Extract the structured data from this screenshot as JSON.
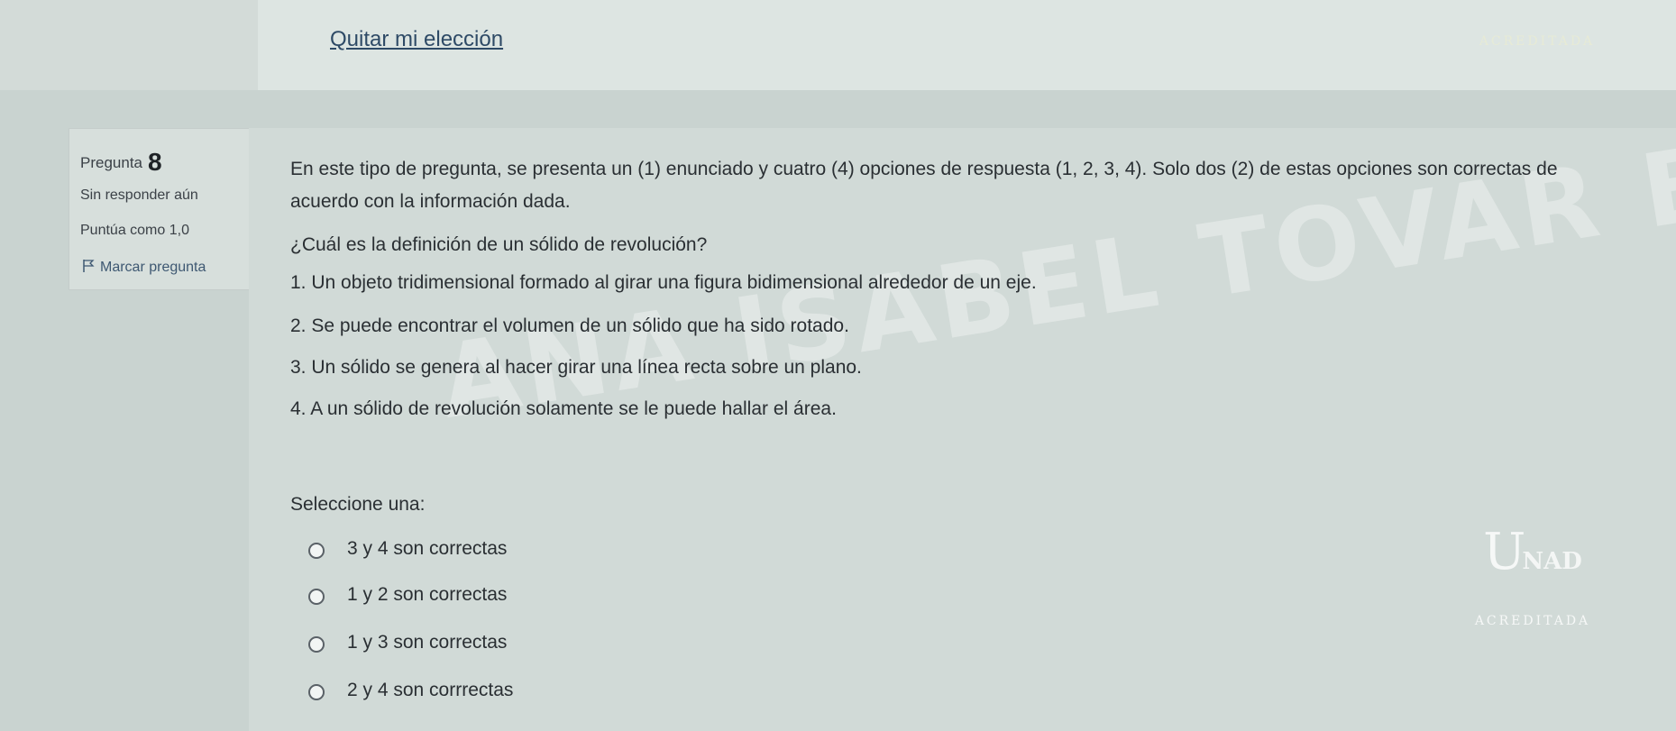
{
  "top": {
    "clear_choice_link": "Quitar mi elección"
  },
  "logo": {
    "acreditada": "ACREDITADA",
    "unad": "NAD"
  },
  "question_info": {
    "label": "Pregunta",
    "number": "8",
    "status": "Sin responder aún",
    "score": "Puntúa como 1,0",
    "flag_label": "Marcar pregunta"
  },
  "question": {
    "instructions_line1": "En este tipo de pregunta, se presenta un (1) enunciado y cuatro (4) opciones de respuesta (1, 2, 3, 4). Solo dos (2) de estas opciones son correctas de",
    "instructions_line2": "acuerdo con la información dada.",
    "prompt": "¿Cuál es la definición de un sólido de revolución?",
    "statements": [
      "1. Un objeto tridimensional formado al girar una figura bidimensional alrededor de un eje.",
      "2. Se puede encontrar el volumen de un sólido que ha sido rotado.",
      "3. Un sólido se genera al hacer girar una línea recta sobre un plano.",
      "4. A un sólido de revolución solamente se le puede hallar el área."
    ],
    "select_label": "Seleccione una:",
    "options": [
      "3 y 4 son correctas",
      "1 y 2 son correctas",
      "1 y 3 son correctas",
      "2 y 4 son corrrectas"
    ]
  },
  "watermark": "ANA ISABEL TOVAR BETTIN"
}
